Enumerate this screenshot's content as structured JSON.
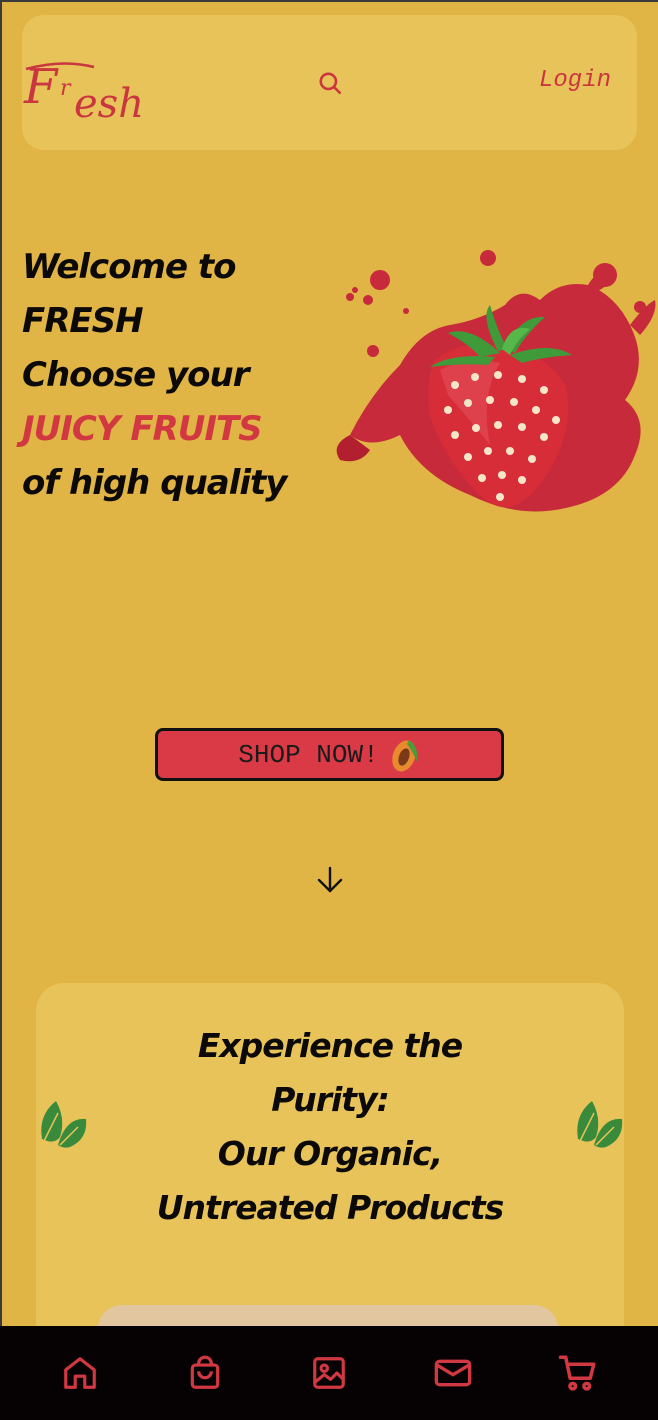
{
  "header": {
    "logo_text": "Fresh",
    "search_icon": "search-icon",
    "login_label": "Login"
  },
  "hero": {
    "line1": "Welcome to",
    "line2": "FRESH",
    "line3": "Choose your",
    "line4_accent": "JUICY FRUITS",
    "line5": "of high quality",
    "image": "strawberry-splash-image"
  },
  "cta": {
    "shop_label": "SHOP NOW!",
    "emoji_icon": "papaya-icon"
  },
  "scroll": {
    "icon": "arrow-down-icon"
  },
  "feature_card": {
    "title_line1": "Experience the",
    "title_line2": "Purity:",
    "title_line3": "Our Organic,",
    "title_line4": "Untreated Products",
    "left_icon": "leaf-icon",
    "right_icon": "leaf-icon"
  },
  "bottom_nav": {
    "items": [
      {
        "icon": "home-icon"
      },
      {
        "icon": "shopping-bag-icon"
      },
      {
        "icon": "image-icon"
      },
      {
        "icon": "mail-icon"
      },
      {
        "icon": "cart-icon"
      }
    ]
  },
  "colors": {
    "background": "#e0b445",
    "panel": "#e8c35a",
    "accent_red": "#d23841",
    "nav_bg": "#060203",
    "leaf_green": "#3a8a3c"
  }
}
